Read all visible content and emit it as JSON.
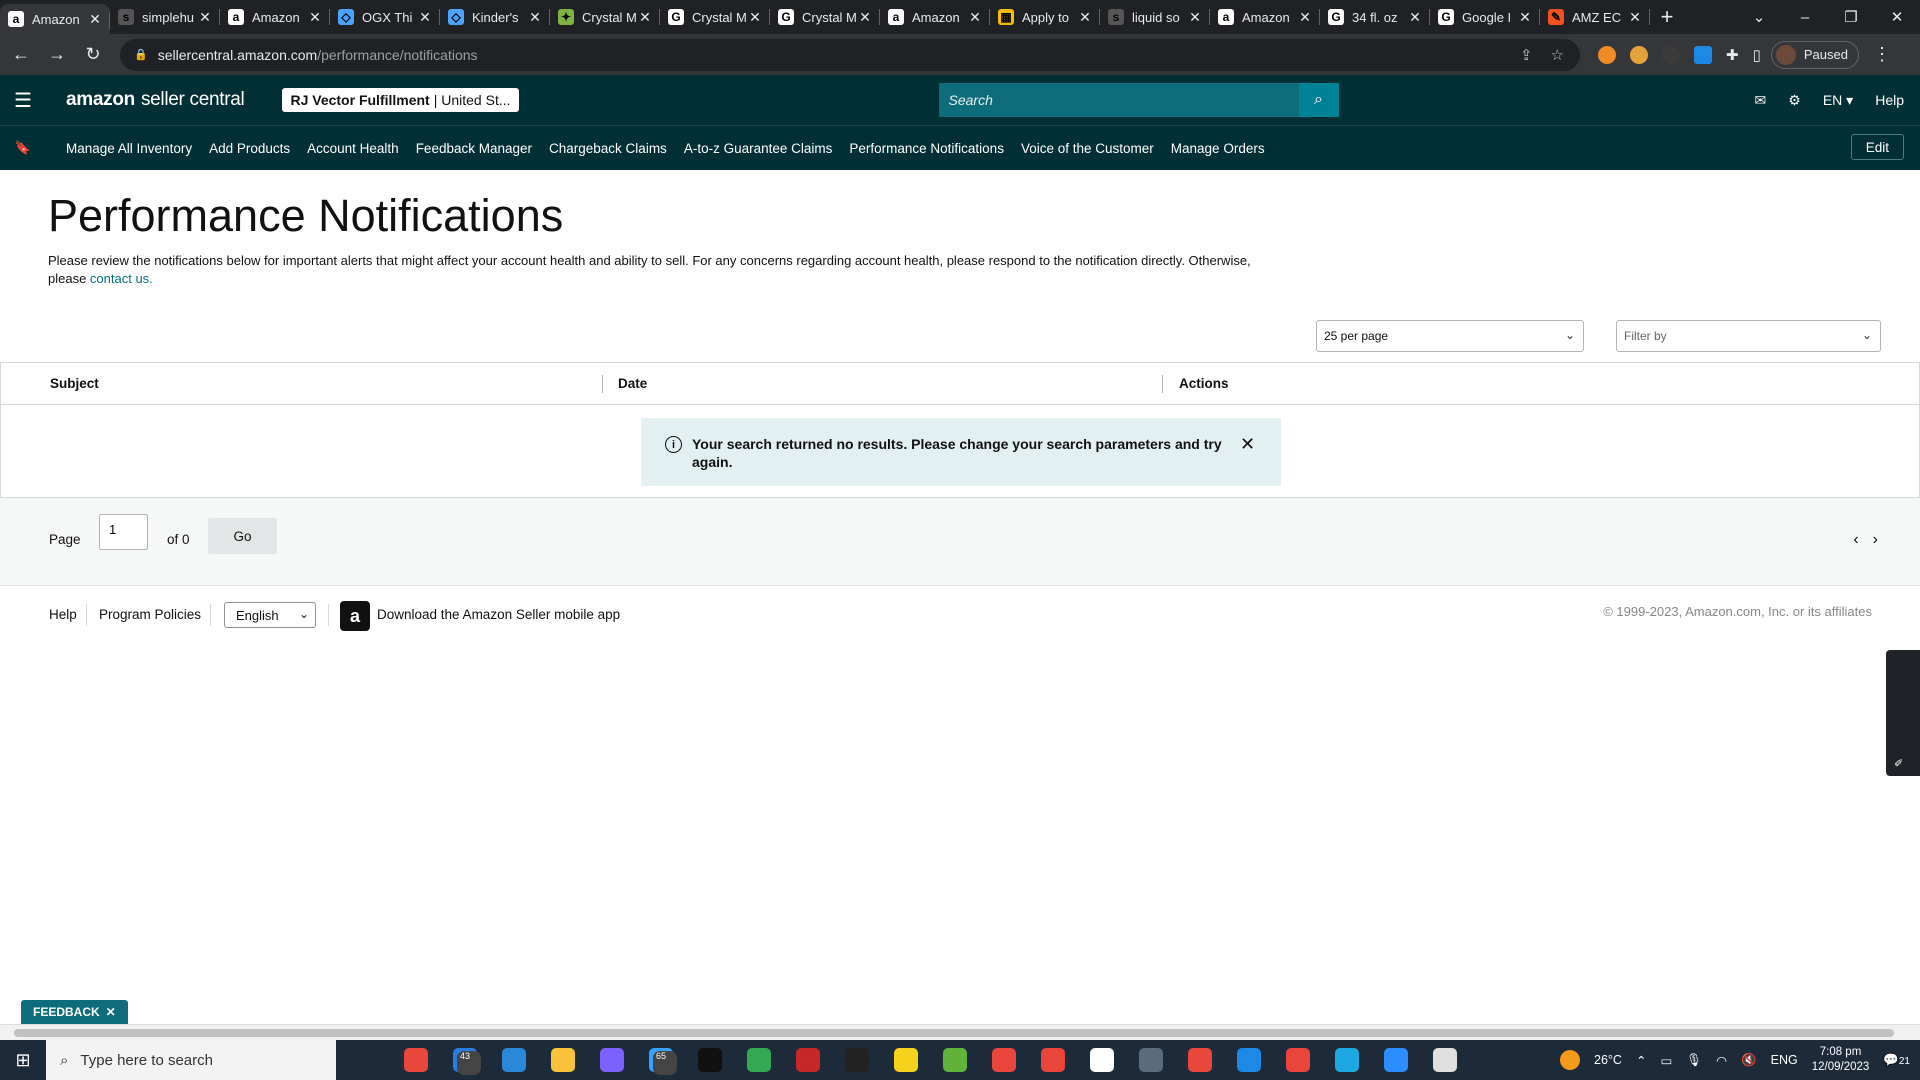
{
  "browser": {
    "tabs": [
      {
        "title": "Amazon",
        "favicon": "a",
        "color": "#ffffff",
        "active": true
      },
      {
        "title": "simplehu",
        "favicon": "s",
        "color": "#555555"
      },
      {
        "title": "Amazon",
        "favicon": "a",
        "color": "#ffffff"
      },
      {
        "title": "OGX Thi",
        "favicon": "◇",
        "color": "#4aa3ff"
      },
      {
        "title": "Kinder's",
        "favicon": "◇",
        "color": "#4aa3ff"
      },
      {
        "title": "Crystal M",
        "favicon": "✦",
        "color": "#7cb342"
      },
      {
        "title": "Crystal M",
        "favicon": "G",
        "color": "#ffffff"
      },
      {
        "title": "Crystal M",
        "favicon": "G",
        "color": "#ffffff"
      },
      {
        "title": "Amazon",
        "favicon": "a",
        "color": "#ffffff"
      },
      {
        "title": "Apply to",
        "favicon": "▦",
        "color": "#fbbc04"
      },
      {
        "title": "liquid so",
        "favicon": "s",
        "color": "#555555"
      },
      {
        "title": "Amazon",
        "favicon": "a",
        "color": "#ffffff"
      },
      {
        "title": "34 fl. oz",
        "favicon": "G",
        "color": "#ffffff"
      },
      {
        "title": "Google I",
        "favicon": "G",
        "color": "#ffffff"
      },
      {
        "title": "AMZ EC",
        "favicon": "✎",
        "color": "#f4511e"
      }
    ],
    "url_domain": "sellercentral.amazon.com",
    "url_path": "/performance/notifications",
    "profile_label": "Paused"
  },
  "header": {
    "logo_bold": "amazon",
    "logo_rest": "seller central",
    "account_name": "RJ Vector Fulfillment",
    "account_region": "| United St...",
    "search_placeholder": "Search",
    "language": "EN",
    "help": "Help"
  },
  "nav": {
    "links": [
      "Manage All Inventory",
      "Add Products",
      "Account Health",
      "Feedback Manager",
      "Chargeback Claims",
      "A-to-z Guarantee Claims",
      "Performance Notifications",
      "Voice of the Customer",
      "Manage Orders"
    ],
    "edit": "Edit"
  },
  "main": {
    "title": "Performance Notifications",
    "description": "Please review the notifications below for important alerts that might affect your account health and ability to sell. For any concerns regarding account health, please respond to the notification directly. Otherwise, please ",
    "contact_link": "contact us.",
    "per_page": "25 per page",
    "filter_placeholder": "Filter by",
    "columns": {
      "subject": "Subject",
      "date": "Date",
      "actions": "Actions"
    },
    "no_results": "Your search returned no results. Please change your search parameters and try again."
  },
  "pager": {
    "page_label": "Page",
    "page_value": "1",
    "of_label": "of 0",
    "go": "Go"
  },
  "footer": {
    "help": "Help",
    "policies": "Program Policies",
    "language": "English",
    "app_text": "Download the Amazon Seller mobile app",
    "copyright": "© 1999-2023, Amazon.com, Inc. or its affiliates"
  },
  "feedback": "FEEDBACK",
  "taskbar": {
    "search_placeholder": "Type here to search",
    "apps": [
      {
        "name": "task-view-icon",
        "color": "#1c2a3a"
      },
      {
        "name": "chrome-icon",
        "color": "#e8453c"
      },
      {
        "name": "mail-icon",
        "color": "#2a7de1",
        "badge": "43"
      },
      {
        "name": "store-icon",
        "color": "#2b88d8"
      },
      {
        "name": "file-explorer-icon",
        "color": "#f8c33a"
      },
      {
        "name": "media-icon",
        "color": "#7b61ff"
      },
      {
        "name": "browser-badge-icon",
        "color": "#3aa0ff",
        "badge": "65"
      },
      {
        "name": "amazon-app-icon",
        "color": "#111111"
      },
      {
        "name": "drive-icon",
        "color": "#34a853"
      },
      {
        "name": "app-red-icon",
        "color": "#c62828"
      },
      {
        "name": "app-dark-icon",
        "color": "#222222"
      },
      {
        "name": "sticky-notes-icon",
        "color": "#f7d21b"
      },
      {
        "name": "utorrent-icon",
        "color": "#61b33c"
      },
      {
        "name": "chrome-profile-icon",
        "color": "#e8453c"
      },
      {
        "name": "chrome-profile2-icon",
        "color": "#e8453c"
      },
      {
        "name": "app-circle-icon",
        "color": "#ffffff"
      },
      {
        "name": "calculator-icon",
        "color": "#5b6b7b"
      },
      {
        "name": "chrome-profile3-icon",
        "color": "#e8453c"
      },
      {
        "name": "app-r-icon",
        "color": "#1e88e5"
      },
      {
        "name": "chrome-profile4-icon",
        "color": "#e8453c"
      },
      {
        "name": "edge-icon",
        "color": "#1ea7e0"
      },
      {
        "name": "zoom-icon",
        "color": "#2d8cff"
      },
      {
        "name": "app-paint-icon",
        "color": "#e0e0e0"
      }
    ],
    "weather": "26°C",
    "lang": "ENG",
    "time": "7:08 pm",
    "date": "12/09/2023",
    "notifications": "21"
  }
}
